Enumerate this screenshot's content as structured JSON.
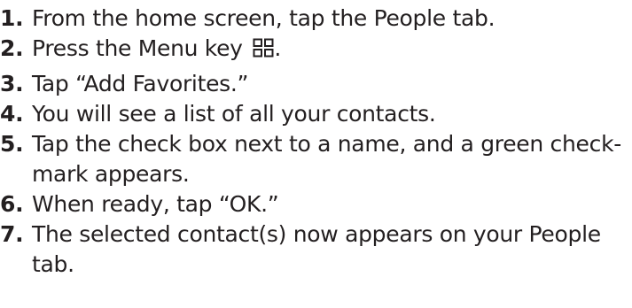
{
  "steps": [
    {
      "number": "1.",
      "text": "From the home screen, tap the People tab."
    },
    {
      "number": "2.",
      "text": "Press the Menu key",
      "icon": "menu-key-icon",
      "after_icon": "."
    },
    {
      "number": "3.",
      "text": "Tap “Add Favorites.”"
    },
    {
      "number": "4.",
      "text": "You will see a list of all your contacts."
    },
    {
      "number": "5.",
      "line1": "Tap the check box next to a name, and a green check-",
      "line2": "mark appears."
    },
    {
      "number": "6.",
      "text": "When ready, tap “OK.”"
    },
    {
      "number": "7.",
      "line1": "The selected contact(s) now appears on your People",
      "line2": "tab."
    }
  ],
  "colors": {
    "text": "#231f20",
    "icon": "#231f20"
  }
}
